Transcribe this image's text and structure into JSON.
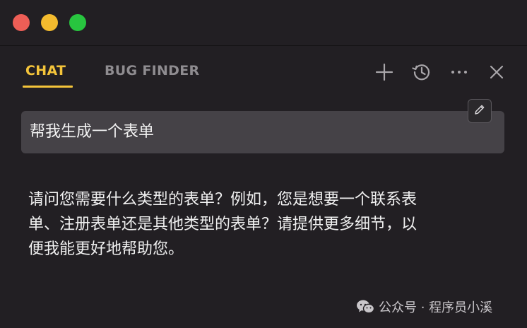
{
  "window": {
    "traffic_lights": [
      "close",
      "minimize",
      "maximize"
    ],
    "colors": {
      "background": "#221f23",
      "accent": "#f4c43a",
      "inactive_tab": "#8f8c90"
    }
  },
  "tabs": [
    {
      "label": "CHAT",
      "active": true
    },
    {
      "label": "BUG FINDER",
      "active": false
    }
  ],
  "toolbar": {
    "icons": [
      "plus-icon",
      "history-icon",
      "more-icon",
      "close-icon"
    ]
  },
  "chat": {
    "user_message": "帮我生成一个表单",
    "edit_icon": "pencil-icon",
    "assistant_lines": [
      "请问您需要什么类型的表单？例如，您是想要一个联系表",
      "单、注册表单还是其他类型的表单？请提供更多细节，以",
      "便我能更好地帮助您。"
    ]
  },
  "watermark": {
    "icon": "wechat-icon",
    "text": "公众号 · 程序员小溪"
  }
}
